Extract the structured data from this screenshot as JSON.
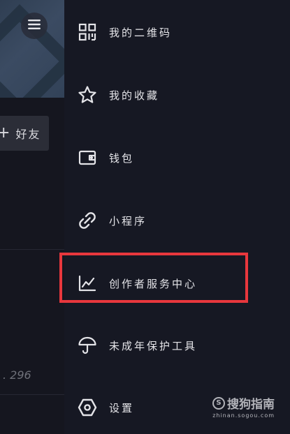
{
  "background_page": {
    "add_friend_label": "好友",
    "add_friend_plus": "+",
    "partial_count": "296"
  },
  "drawer": {
    "items": [
      {
        "label": "我的二维码",
        "icon": "qr-code-icon"
      },
      {
        "label": "我的收藏",
        "icon": "star-icon"
      },
      {
        "label": "钱包",
        "icon": "wallet-icon"
      },
      {
        "label": "小程序",
        "icon": "link-icon"
      },
      {
        "label": "创作者服务中心",
        "icon": "chart-line-icon"
      },
      {
        "label": "未成年保护工具",
        "icon": "umbrella-icon"
      },
      {
        "label": "设置",
        "icon": "hexagon-settings-icon"
      }
    ]
  },
  "watermark": {
    "brand": "搜狗指南",
    "url": "zhinan.sogou.com"
  },
  "colors": {
    "drawer_bg": "#161823",
    "text": "#e4e4e8",
    "highlight": "#e8373d"
  }
}
